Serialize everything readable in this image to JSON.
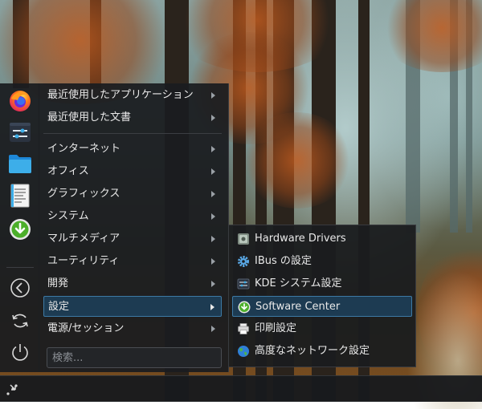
{
  "favorites": [
    {
      "name": "firefox-icon"
    },
    {
      "name": "system-settings-icon"
    },
    {
      "name": "file-manager-icon"
    },
    {
      "name": "text-editor-icon"
    },
    {
      "name": "software-center-icon"
    }
  ],
  "panel_actions": [
    {
      "name": "back-icon"
    },
    {
      "name": "refresh-icon"
    },
    {
      "name": "power-icon"
    }
  ],
  "menu": {
    "items": [
      {
        "label": "最近使用したアプリケーション"
      },
      {
        "label": "最近使用した文書"
      },
      {
        "label": "インターネット"
      },
      {
        "label": "オフィス"
      },
      {
        "label": "グラフィックス"
      },
      {
        "label": "システム"
      },
      {
        "label": "マルチメディア"
      },
      {
        "label": "ユーティリティ"
      },
      {
        "label": "開発"
      },
      {
        "label": "設定"
      },
      {
        "label": "電源/セッション"
      }
    ]
  },
  "search": {
    "placeholder": "検索..."
  },
  "submenu": {
    "items": [
      {
        "label": "Hardware Drivers",
        "icon": "hardware-drivers-icon"
      },
      {
        "label": "IBus の設定",
        "icon": "ibus-gear-icon"
      },
      {
        "label": "KDE システム設定",
        "icon": "kde-settings-icon"
      },
      {
        "label": "Software Center",
        "icon": "software-center-icon"
      },
      {
        "label": "印刷設定",
        "icon": "printer-icon"
      },
      {
        "label": "高度なネットワーク設定",
        "icon": "globe-icon"
      }
    ]
  },
  "colors": {
    "highlight_bg": "#1d3b52",
    "highlight_border": "#3d7aa5",
    "panel_bg": "#1a1c1f"
  }
}
